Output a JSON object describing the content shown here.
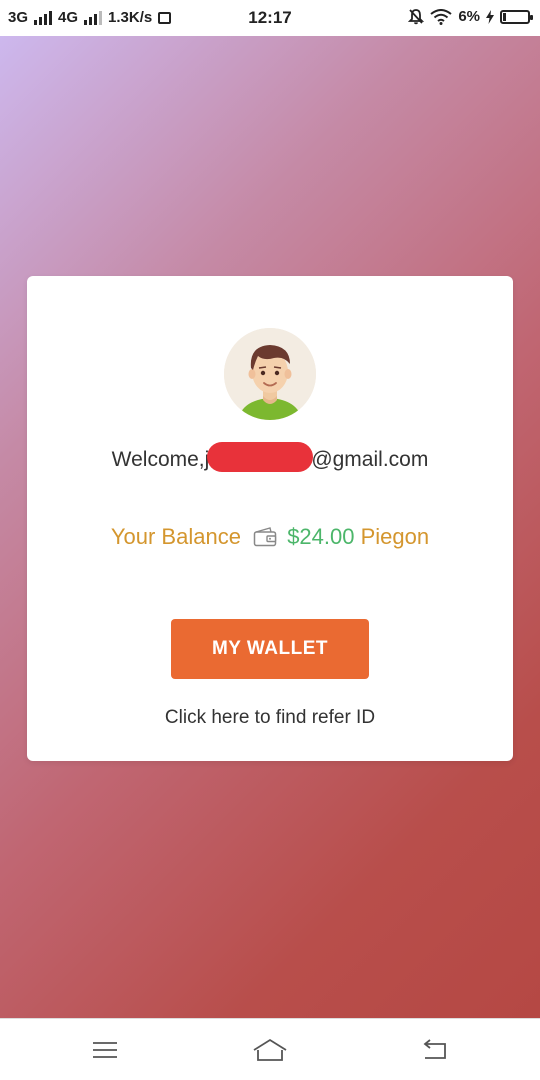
{
  "status_bar": {
    "network_1": "3G",
    "network_2": "4G",
    "speed": "1.3K/s",
    "time": "12:17",
    "battery_pct": "6%"
  },
  "card": {
    "welcome_prefix": "Welcome,j",
    "welcome_suffix": "@gmail.com",
    "balance_label": "Your Balance",
    "balance_amount": "$24.00",
    "balance_currency": "Piegon",
    "wallet_button": "MY WALLET",
    "refer_link": "Click here to find refer ID"
  },
  "nav_bar": {
    "icons": [
      "menu-icon",
      "home-icon",
      "back-icon"
    ]
  },
  "colors": {
    "accent_button": "#ea6a32",
    "balance_label": "#d4962e",
    "balance_amount": "#4cb66a",
    "redaction": "#e8323a"
  }
}
